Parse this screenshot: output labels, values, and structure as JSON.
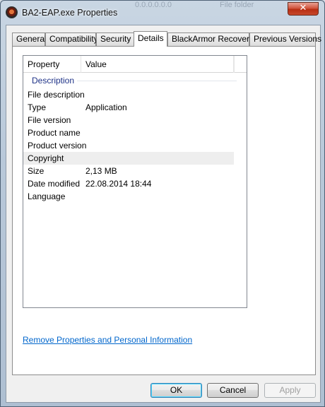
{
  "window": {
    "title": "BA2-EAP.exe Properties",
    "background_ghost_left": "0.0.0.0.0.0",
    "background_ghost_right": "File folder",
    "close_glyph": "✕"
  },
  "tabs": [
    {
      "label": "General"
    },
    {
      "label": "Compatibility"
    },
    {
      "label": "Security"
    },
    {
      "label": "Details"
    },
    {
      "label": "BlackArmor Recovery"
    },
    {
      "label": "Previous Versions"
    }
  ],
  "active_tab": "Details",
  "details": {
    "headers": {
      "property": "Property",
      "value": "Value"
    },
    "group": "Description",
    "rows": [
      {
        "property": "File description",
        "value": ""
      },
      {
        "property": "Type",
        "value": "Application"
      },
      {
        "property": "File version",
        "value": ""
      },
      {
        "property": "Product name",
        "value": ""
      },
      {
        "property": "Product version",
        "value": ""
      },
      {
        "property": "Copyright",
        "value": ""
      },
      {
        "property": "Size",
        "value": "2,13 MB"
      },
      {
        "property": "Date modified",
        "value": "22.08.2014 18:44"
      },
      {
        "property": "Language",
        "value": ""
      }
    ]
  },
  "remove_link": "Remove Properties and Personal Information",
  "buttons": {
    "ok": "OK",
    "cancel": "Cancel",
    "apply": "Apply"
  },
  "icons": {
    "app": "app-icon",
    "close": "close-icon"
  },
  "colors": {
    "link": "#0066cc",
    "group_header": "#1e3287",
    "close_button": "#c7482c"
  }
}
